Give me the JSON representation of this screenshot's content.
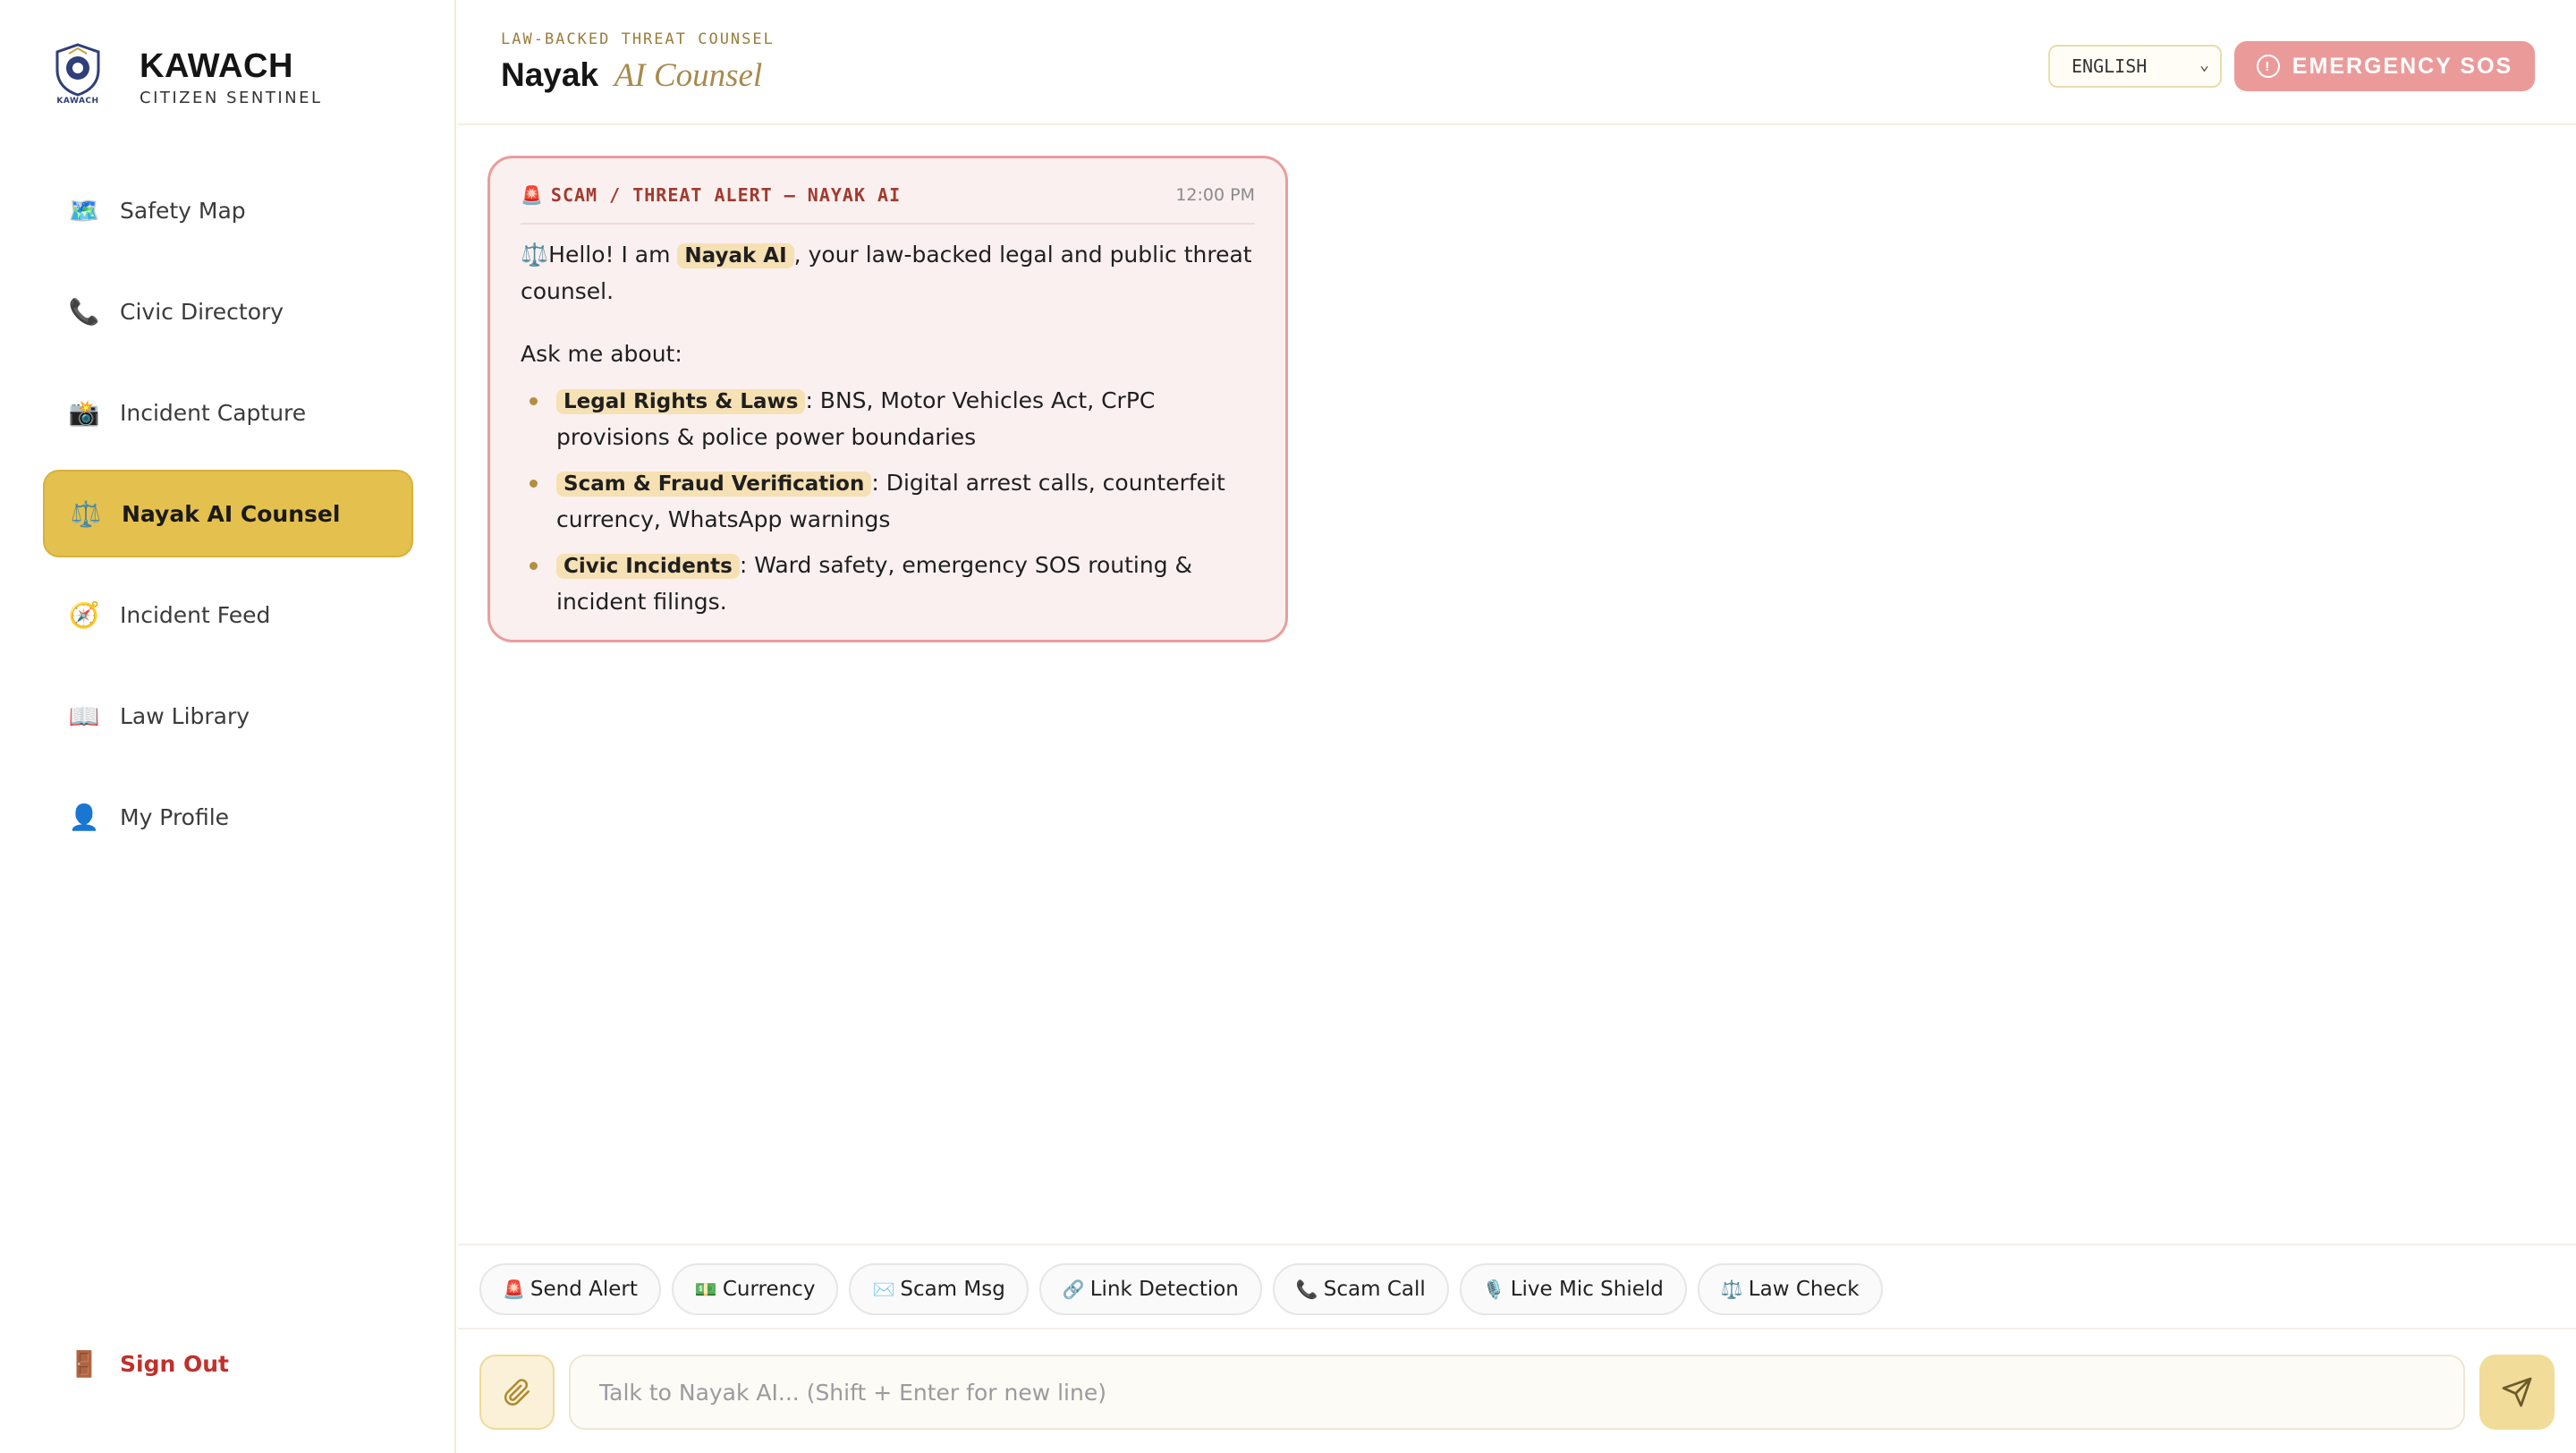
{
  "app": {
    "brand_title": "KAWACH",
    "brand_subtitle": "CITIZEN SENTINEL",
    "logo_text": "KAWACH"
  },
  "sidebar": {
    "items": [
      {
        "label": "Safety Map",
        "icon": "map-icon",
        "glyph": "🗺️",
        "active": false
      },
      {
        "label": "Civic Directory",
        "icon": "phone-icon",
        "glyph": "📞",
        "active": false
      },
      {
        "label": "Incident Capture",
        "icon": "camera-icon",
        "glyph": "📸",
        "active": false
      },
      {
        "label": "Nayak AI Counsel",
        "icon": "scales-icon",
        "glyph": "⚖️",
        "active": true
      },
      {
        "label": "Incident Feed",
        "icon": "compass-icon",
        "glyph": "🧭",
        "active": false
      },
      {
        "label": "Law Library",
        "icon": "book-icon",
        "glyph": "📖",
        "active": false
      },
      {
        "label": "My Profile",
        "icon": "user-icon",
        "glyph": "👤",
        "active": false
      }
    ],
    "signout_label": "Sign Out",
    "signout_icon": "door-icon",
    "signout_glyph": "🚪"
  },
  "header": {
    "eyebrow": "LAW-BACKED THREAT COUNSEL",
    "title_main": "Nayak",
    "title_accent": "AI Counsel",
    "language": "ENGLISH",
    "sos_label": "EMERGENCY SOS"
  },
  "message": {
    "tag": "SCAM / THREAT ALERT — NAYAK AI",
    "tag_glyph": "🚨",
    "time": "12:00 PM",
    "greeting_glyph": "⚖️",
    "greeting_pre": "Hello! I am",
    "greeting_name": "Nayak AI",
    "greeting_post": ", your law-backed legal and public threat counsel.",
    "ask": "Ask me about:",
    "bullets": [
      {
        "title": "Legal Rights & Laws",
        "text": ": BNS, Motor Vehicles Act, CrPC provisions & police power boundaries"
      },
      {
        "title": "Scam & Fraud Verification",
        "text": ": Digital arrest calls, counterfeit currency, WhatsApp warnings"
      },
      {
        "title": "Civic Incidents",
        "text": ": Ward safety, emergency SOS routing & incident filings."
      }
    ]
  },
  "quick_actions": [
    {
      "label": "Send Alert",
      "glyph": "🚨",
      "icon": "siren-icon"
    },
    {
      "label": "Currency",
      "glyph": "💵",
      "icon": "banknote-icon"
    },
    {
      "label": "Scam Msg",
      "glyph": "✉️",
      "icon": "envelope-icon"
    },
    {
      "label": "Link Detection",
      "glyph": "🔗",
      "icon": "link-icon"
    },
    {
      "label": "Scam Call",
      "glyph": "📞",
      "icon": "phone-icon"
    },
    {
      "label": "Live Mic Shield",
      "glyph": "🎙️",
      "icon": "microphone-icon"
    },
    {
      "label": "Law Check",
      "glyph": "⚖️",
      "icon": "scales-icon"
    }
  ],
  "composer": {
    "placeholder": "Talk to Nayak AI... (Shift + Enter for new line)",
    "value": ""
  },
  "colors": {
    "accent_gold": "#e4c04e",
    "sos_red": "#eb9a9a",
    "alert_border": "#eb9c9c",
    "alert_bg": "#fbf0f0"
  }
}
